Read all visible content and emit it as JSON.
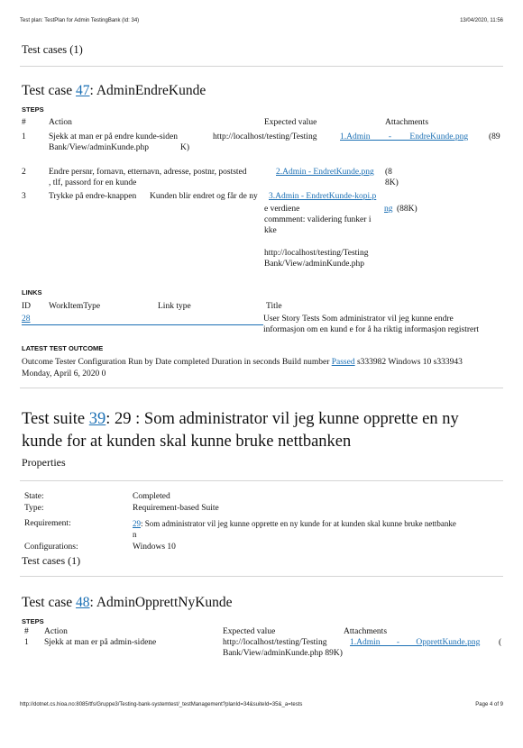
{
  "header": {
    "left": "Test plan: TestPlan for Admin TestingBank (Id: 34)",
    "right": "13/04/2020, 11:56"
  },
  "tc_section": "Test cases (1)",
  "tc47": {
    "prefix": "Test case ",
    "id": "47",
    "name": ": AdminEndreKunde",
    "steps_label": "STEPS",
    "cols": [
      "#",
      "Action",
      "Expected value",
      "Attachments"
    ],
    "rows": [
      {
        "num": "1",
        "action": [
          "Sjekk at man er på endre kunde-siden",
          "Bank/View/adminKunde.php"
        ],
        "expected": "http://localhost/testing/Testing",
        "attach_link": "1.Admin - EndreKunde.png",
        "attach_size": "(89",
        "attach_size2": "K)"
      },
      {
        "num": "2",
        "action": [
          "Endre persnr, fornavn, etternavn, adresse, postnr, poststed",
          ", tlf, passord for en kunde"
        ],
        "attach_link": "2.Admin - EndretKunde.png",
        "attach_size": "(8",
        "attach_size2": "8K)"
      },
      {
        "num": "3",
        "action": [
          "Trykke på endre-knappen"
        ],
        "expected": [
          "Kunden blir endret og får de ny",
          "e verdiene",
          "commment: validering funker i",
          "kke",
          "http://localhost/testing/Testing",
          "Bank/View/adminKunde.php"
        ],
        "attach_link": "3.Admin - EndretKunde-kopi.p",
        "attach_link2": "ng",
        "attach_size": "(88K)"
      }
    ],
    "links_label": "LINKS",
    "links_cols": [
      "ID",
      "WorkItemType",
      "Link type",
      "Title"
    ],
    "link_row": {
      "id": "28",
      "title": [
        "User Story Tests  Som administrator vil jeg kunne endre",
        "informasjon om en kund e for å ha riktig informasjon registrert"
      ]
    },
    "outcome_label": "LATEST TEST OUTCOME",
    "outcome_line1": "Outcome Tester Configuration Run by Date completed Duration in seconds Build number ",
    "outcome_link": "Passed",
    "outcome_rest": " s333982 Windows 10 s333943",
    "outcome_line2": "Monday, April 6, 2020 0"
  },
  "suite": {
    "prefix": "Test suite ",
    "id": "39",
    "title1": ": 29 : Som administrator vil jeg kunne opprette en ny",
    "title2": "kunde for at kunden skal kunne bruke nettbanken",
    "props_label": "Properties",
    "state_label": "State:",
    "state": "Completed",
    "type_label": "Type:",
    "type": "Requirement-based Suite",
    "req_label": "Requirement:",
    "req_link": "29",
    "req_text": ": Som administrator vil jeg kunne opprette en ny kunde for at kunden skal kunne bruke nettbanke",
    "req_text2": "n",
    "conf_label": "Configurations:",
    "conf": "Windows 10",
    "tc_count": "Test cases (1)"
  },
  "tc48": {
    "prefix": "Test case ",
    "id": "48",
    "name": ": AdminOpprettNyKunde",
    "steps_label": "STEPS",
    "cols": [
      "#",
      "Action",
      "Expected value",
      "Attachments"
    ],
    "row": {
      "num": "1",
      "action": "Sjekk at man er på admin-sidene",
      "expected": [
        "http://localhost/testing/Testing",
        "Bank/View/adminKunde.php 89K)"
      ],
      "attach_link": "1.Admin - OpprettKunde.png",
      "attach_size": "("
    }
  },
  "footer": {
    "left": "http://dotnet.cs.hioa.no:8085/tfs/Gruppe3/Testing-bank-systemtest/_testManagement?planId=34&suiteId=35&_a=tests",
    "right": "Page 4 of 9"
  }
}
